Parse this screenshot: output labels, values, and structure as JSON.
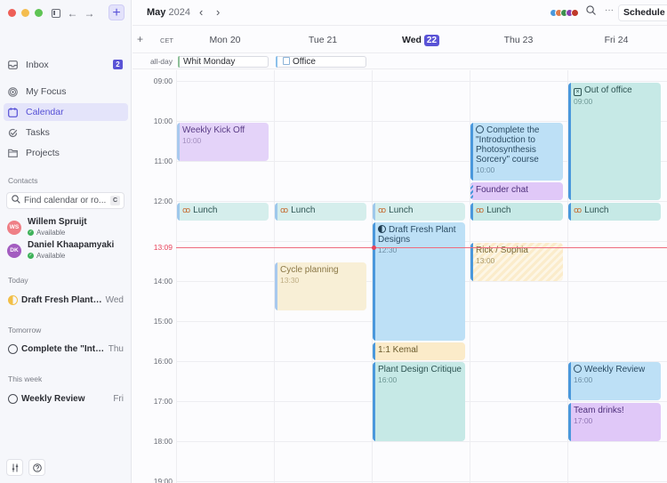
{
  "window": {
    "traffic_lights": [
      "close",
      "minimize",
      "zoom"
    ],
    "new_button_label": "+"
  },
  "sidebar": {
    "nav": [
      {
        "label": "Inbox",
        "icon": "inbox-icon",
        "badge": "2",
        "active": false
      },
      {
        "label": "My Focus",
        "icon": "focus-icon",
        "active": false
      },
      {
        "label": "Calendar",
        "icon": "calendar-icon",
        "active": true
      },
      {
        "label": "Tasks",
        "icon": "tasks-icon",
        "active": false
      },
      {
        "label": "Projects",
        "icon": "folder-icon",
        "active": false
      }
    ],
    "contacts_label": "Contacts",
    "search_placeholder": "Find calendar or ro...",
    "search_shortcut": "C",
    "contacts": [
      {
        "initials": "WS",
        "name": "Willem Spruijt",
        "status": "Available",
        "color": "#ef7f86"
      },
      {
        "initials": "DK",
        "name": "Daniel Khaapamyaki",
        "status": "Available",
        "color": "#a35cc0"
      }
    ],
    "task_groups": [
      {
        "label": "Today",
        "tasks": [
          {
            "title": "Draft Fresh Plant D...",
            "day": "Wed",
            "state": "in-progress"
          }
        ]
      },
      {
        "label": "Tomorrow",
        "tasks": [
          {
            "title": "Complete the \"Intro...",
            "day": "Thu",
            "state": "open"
          }
        ]
      },
      {
        "label": "This week",
        "tasks": [
          {
            "title": "Weekly Review",
            "day": "Fri",
            "state": "open"
          }
        ]
      }
    ]
  },
  "toolbar": {
    "month": "May",
    "year": "2024",
    "prev_icon": "‹",
    "next_icon": "›",
    "participant_colors": [
      "#4a98dc",
      "#e07a4a",
      "#3f8f4f",
      "#8a3fb0",
      "#c0392b"
    ],
    "search_icon": "⌕",
    "more_icon": "···",
    "schedule_label": "Schedule"
  },
  "calendar": {
    "add_label": "+",
    "timezone": "CET",
    "days": [
      {
        "name": "Mon",
        "num": "20",
        "today": false
      },
      {
        "name": "Tue",
        "num": "21",
        "today": false
      },
      {
        "name": "Wed",
        "num": "22",
        "today": true
      },
      {
        "name": "Thu",
        "num": "23",
        "today": false
      },
      {
        "name": "Fri",
        "num": "24",
        "today": false
      }
    ],
    "allday_label": "all-day",
    "allday_events": [
      {
        "title": "Whit Monday",
        "day": 0
      },
      {
        "title": "Office",
        "day": 1
      }
    ],
    "hours": [
      "09:00",
      "10:00",
      "11:00",
      "12:00",
      "13:00",
      "14:00",
      "15:00",
      "16:00",
      "17:00",
      "18:00",
      "19:00"
    ],
    "now_label": "13:09",
    "events": [
      {
        "title": "Weekly Kick Off",
        "time": "10:00"
      },
      {
        "title": "Lunch"
      },
      {
        "title": "Lunch"
      },
      {
        "title": "Lunch"
      },
      {
        "title": "Lunch"
      },
      {
        "title": "Lunch"
      },
      {
        "title": "Cycle planning",
        "time": "13:30"
      },
      {
        "title": "Draft Fresh Plant Designs",
        "time": "12:30"
      },
      {
        "title": "1:1 Kemal"
      },
      {
        "title": "Plant Design Critique",
        "time": "16:00"
      },
      {
        "title": "Complete the \"Introduction to Photosynthesis Sorcery\" course",
        "time": "10:00"
      },
      {
        "title": "Founder chat"
      },
      {
        "title": "Rick / Sophia",
        "time": "13:00"
      },
      {
        "title": "Out of office",
        "time": "09:00"
      },
      {
        "title": "Weekly Review",
        "time": "16:00"
      },
      {
        "title": "Team drinks!",
        "time": "17:00"
      }
    ]
  }
}
